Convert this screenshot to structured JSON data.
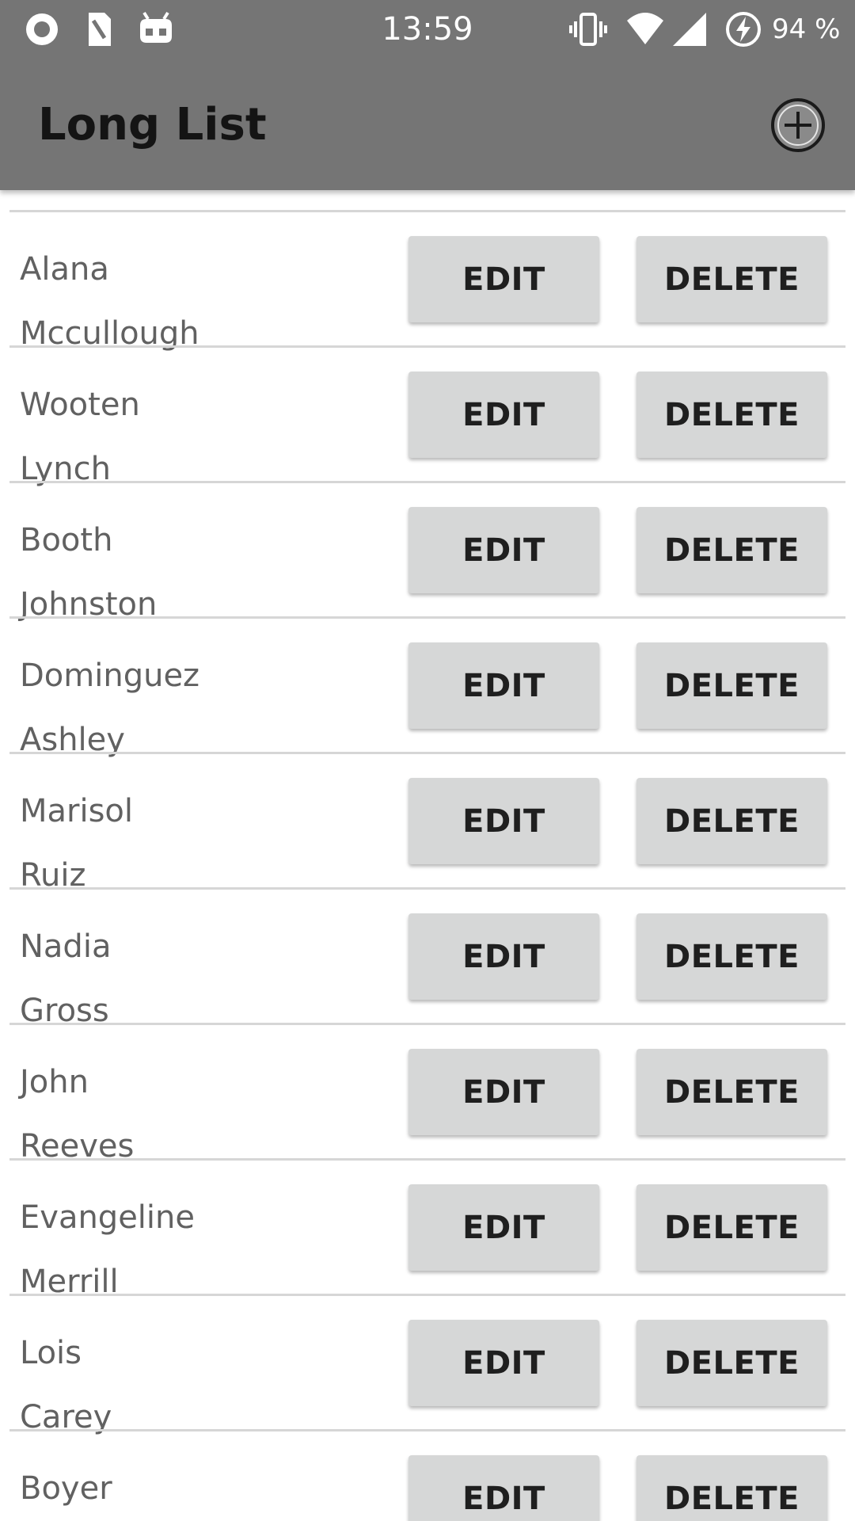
{
  "status_bar": {
    "time": "13:59",
    "battery": "94 %",
    "left_icons": [
      "record-icon",
      "sim-card-icon",
      "android-debug-icon"
    ],
    "right_icons": [
      "vibrate-icon",
      "wifi-icon",
      "cell-signal-icon",
      "battery-charging-icon"
    ]
  },
  "app_bar": {
    "title": "Long List",
    "add_icon": "add-circle-icon",
    "color": "#757575"
  },
  "buttons": {
    "edit_label": "EDIT",
    "delete_label": "DELETE"
  },
  "list": {
    "items": [
      {
        "first": "Alana",
        "last": "Mccullough"
      },
      {
        "first": "Wooten",
        "last": "Lynch"
      },
      {
        "first": "Booth",
        "last": "Johnston"
      },
      {
        "first": "Dominguez",
        "last": "Ashley"
      },
      {
        "first": "Marisol",
        "last": "Ruiz"
      },
      {
        "first": "Nadia",
        "last": "Gross"
      },
      {
        "first": "John",
        "last": "Reeves"
      },
      {
        "first": "Evangeline",
        "last": "Merrill"
      },
      {
        "first": "Lois",
        "last": "Carey"
      },
      {
        "first": "Boyer",
        "last": ""
      }
    ]
  }
}
